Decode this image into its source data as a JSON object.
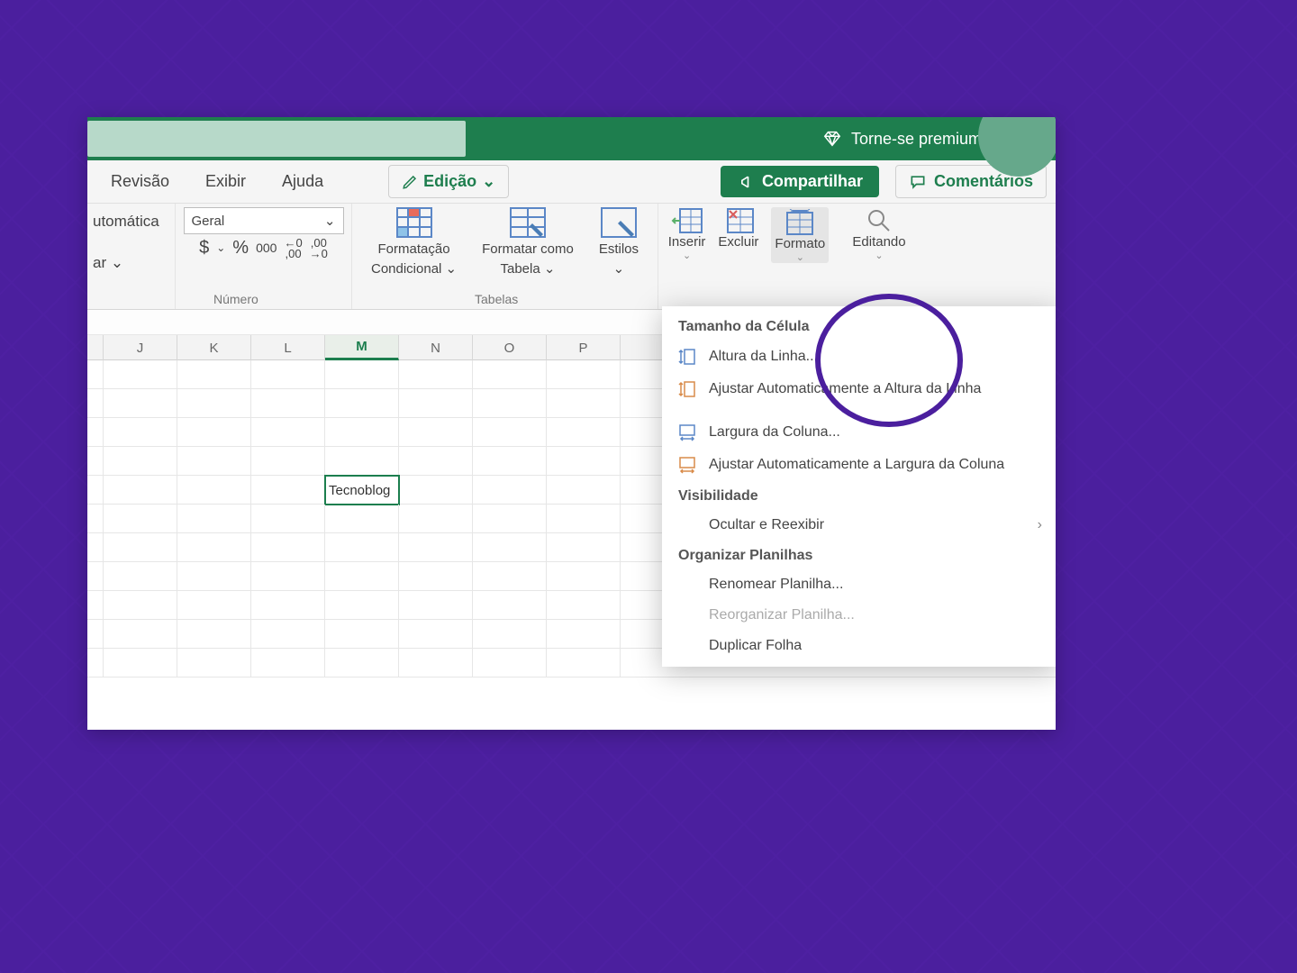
{
  "titlebar": {
    "premium_label": "Torne-se premium"
  },
  "tabs": {
    "revisao": "Revisão",
    "exibir": "Exibir",
    "ajuda": "Ajuda",
    "edicao": "Edição"
  },
  "actions": {
    "share": "Compartilhar",
    "comments": "Comentários"
  },
  "ribbon": {
    "auto_line1": "utomática",
    "auto_line2": "ar ⌄",
    "number_format": "Geral",
    "number_group_label": "Número",
    "currency": "$",
    "percent": "%",
    "thousands": "000",
    "inc_dec_left": "←0\n,00",
    "inc_dec_right": ",00\n→0",
    "tables_group_label": "Tabelas",
    "cond_fmt_line1": "Formatação",
    "cond_fmt_line2": "Condicional ⌄",
    "fmt_table_line1": "Formatar como",
    "fmt_table_line2": "Tabela ⌄",
    "styles_line1": "Estilos",
    "styles_line2": "⌄",
    "insert": "Inserir",
    "insert_drop": "⌄",
    "delete": "Excluir",
    "format": "Formato",
    "format_drop": "⌄",
    "editing": "Editando",
    "editing_drop": "⌄"
  },
  "columns": [
    "J",
    "K",
    "L",
    "M",
    "N",
    "O",
    "P"
  ],
  "active_column_index": 3,
  "cell_value": "Tecnoblog",
  "active_cell_row": 4,
  "dropdown": {
    "section_size": "Tamanho da Célula",
    "row_height": "Altura da Linha...",
    "autofit_row": "Ajustar Automaticamente a Altura da Linha",
    "col_width": "Largura da Coluna...",
    "autofit_col": "Ajustar Automaticamente a Largura da Coluna",
    "section_vis": "Visibilidade",
    "hide_show": "Ocultar e Reexibir",
    "section_org": "Organizar Planilhas",
    "rename": "Renomear Planilha...",
    "reorganize": "Reorganizar Planilha...",
    "duplicate": "Duplicar Folha"
  }
}
